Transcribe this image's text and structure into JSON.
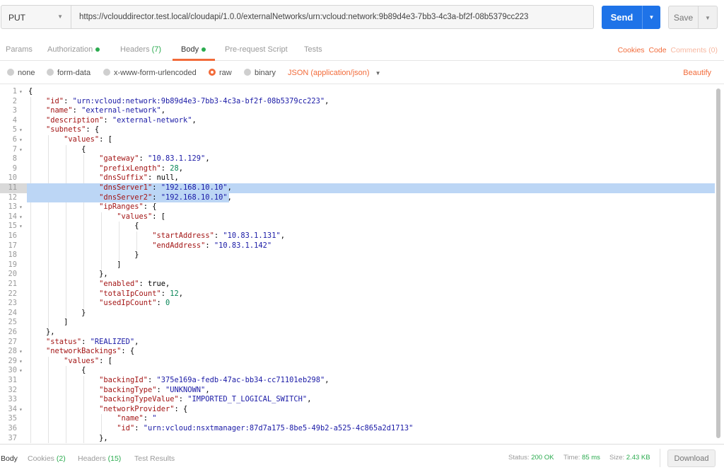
{
  "request": {
    "method": "PUT",
    "url": "https://vclouddirector.test.local/cloudapi/1.0.0/externalNetworks/urn:vcloud:network:9b89d4e3-7bb3-4c3a-bf2f-08b5379cc223",
    "send_label": "Send",
    "save_label": "Save"
  },
  "request_tabs": [
    {
      "label": "Params"
    },
    {
      "label": "Authorization"
    },
    {
      "label": "Headers",
      "count": "(7)"
    },
    {
      "label": "Body"
    },
    {
      "label": "Pre-request Script"
    },
    {
      "label": "Tests"
    }
  ],
  "right_links": {
    "cookies": "Cookies",
    "code": "Code",
    "comments": "Comments (0)"
  },
  "body_types": {
    "none": "none",
    "form_data": "form-data",
    "urlencoded": "x-www-form-urlencoded",
    "raw": "raw",
    "binary": "binary",
    "format": "JSON (application/json)",
    "beautify": "Beautify"
  },
  "editor": {
    "lines": [
      {
        "n": "1",
        "fold": true,
        "indent": 0,
        "tokens": [
          [
            "p",
            "{"
          ]
        ]
      },
      {
        "n": "2",
        "indent": 1,
        "tokens": [
          [
            "k",
            "\"id\""
          ],
          [
            "p",
            ": "
          ],
          [
            "s",
            "\"urn:vcloud:network:9b89d4e3-7bb3-4c3a-bf2f-08b5379cc223\""
          ],
          [
            "p",
            ","
          ]
        ]
      },
      {
        "n": "3",
        "indent": 1,
        "tokens": [
          [
            "k",
            "\"name\""
          ],
          [
            "p",
            ": "
          ],
          [
            "s",
            "\"external-network\""
          ],
          [
            "p",
            ","
          ]
        ]
      },
      {
        "n": "4",
        "indent": 1,
        "tokens": [
          [
            "k",
            "\"description\""
          ],
          [
            "p",
            ": "
          ],
          [
            "s",
            "\"external-network\""
          ],
          [
            "p",
            ","
          ]
        ]
      },
      {
        "n": "5",
        "fold": true,
        "indent": 1,
        "tokens": [
          [
            "k",
            "\"subnets\""
          ],
          [
            "p",
            ": {"
          ]
        ]
      },
      {
        "n": "6",
        "fold": true,
        "indent": 2,
        "tokens": [
          [
            "k",
            "\"values\""
          ],
          [
            "p",
            ": ["
          ]
        ]
      },
      {
        "n": "7",
        "fold": true,
        "indent": 3,
        "tokens": [
          [
            "p",
            "{"
          ]
        ]
      },
      {
        "n": "8",
        "indent": 4,
        "tokens": [
          [
            "k",
            "\"gateway\""
          ],
          [
            "p",
            ": "
          ],
          [
            "s",
            "\"10.83.1.129\""
          ],
          [
            "p",
            ","
          ]
        ]
      },
      {
        "n": "9",
        "indent": 4,
        "tokens": [
          [
            "k",
            "\"prefixLength\""
          ],
          [
            "p",
            ": "
          ],
          [
            "n",
            "28"
          ],
          [
            "p",
            ","
          ]
        ]
      },
      {
        "n": "10",
        "indent": 4,
        "tokens": [
          [
            "k",
            "\"dnsSuffix\""
          ],
          [
            "p",
            ": null,"
          ]
        ]
      },
      {
        "n": "11",
        "indent": 4,
        "hl": "full",
        "tokens": [
          [
            "k",
            "\"dnsServer1\""
          ],
          [
            "p",
            ": "
          ],
          [
            "s",
            "\"192.168.10.10\""
          ],
          [
            "p",
            ","
          ]
        ]
      },
      {
        "n": "12",
        "indent": 4,
        "hl": "part",
        "tokens": [
          [
            "k",
            "\"dnsServer2\""
          ],
          [
            "p",
            ": "
          ],
          [
            "s",
            "\"192.168.10.10\""
          ],
          [
            "p",
            ","
          ]
        ]
      },
      {
        "n": "13",
        "fold": true,
        "indent": 4,
        "tokens": [
          [
            "k",
            "\"ipRanges\""
          ],
          [
            "p",
            ": {"
          ]
        ]
      },
      {
        "n": "14",
        "fold": true,
        "indent": 5,
        "tokens": [
          [
            "k",
            "\"values\""
          ],
          [
            "p",
            ": ["
          ]
        ]
      },
      {
        "n": "15",
        "fold": true,
        "indent": 6,
        "tokens": [
          [
            "p",
            "{"
          ]
        ]
      },
      {
        "n": "16",
        "indent": 7,
        "tokens": [
          [
            "k",
            "\"startAddress\""
          ],
          [
            "p",
            ": "
          ],
          [
            "s",
            "\"10.83.1.131\""
          ],
          [
            "p",
            ","
          ]
        ]
      },
      {
        "n": "17",
        "indent": 7,
        "tokens": [
          [
            "k",
            "\"endAddress\""
          ],
          [
            "p",
            ": "
          ],
          [
            "s",
            "\"10.83.1.142\""
          ]
        ]
      },
      {
        "n": "18",
        "indent": 6,
        "tokens": [
          [
            "p",
            "}"
          ]
        ]
      },
      {
        "n": "19",
        "indent": 5,
        "tokens": [
          [
            "p",
            "]"
          ]
        ]
      },
      {
        "n": "20",
        "indent": 4,
        "tokens": [
          [
            "p",
            "},"
          ]
        ]
      },
      {
        "n": "21",
        "indent": 4,
        "tokens": [
          [
            "k",
            "\"enabled\""
          ],
          [
            "p",
            ": true,"
          ]
        ]
      },
      {
        "n": "22",
        "indent": 4,
        "tokens": [
          [
            "k",
            "\"totalIpCount\""
          ],
          [
            "p",
            ": "
          ],
          [
            "n",
            "12"
          ],
          [
            "p",
            ","
          ]
        ]
      },
      {
        "n": "23",
        "indent": 4,
        "tokens": [
          [
            "k",
            "\"usedIpCount\""
          ],
          [
            "p",
            ": "
          ],
          [
            "n",
            "0"
          ]
        ]
      },
      {
        "n": "24",
        "indent": 3,
        "tokens": [
          [
            "p",
            "}"
          ]
        ]
      },
      {
        "n": "25",
        "indent": 2,
        "tokens": [
          [
            "p",
            "]"
          ]
        ]
      },
      {
        "n": "26",
        "indent": 1,
        "tokens": [
          [
            "p",
            "},"
          ]
        ]
      },
      {
        "n": "27",
        "indent": 1,
        "tokens": [
          [
            "k",
            "\"status\""
          ],
          [
            "p",
            ": "
          ],
          [
            "s",
            "\"REALIZED\""
          ],
          [
            "p",
            ","
          ]
        ]
      },
      {
        "n": "28",
        "fold": true,
        "indent": 1,
        "tokens": [
          [
            "k",
            "\"networkBackings\""
          ],
          [
            "p",
            ": {"
          ]
        ]
      },
      {
        "n": "29",
        "fold": true,
        "indent": 2,
        "tokens": [
          [
            "k",
            "\"values\""
          ],
          [
            "p",
            ": ["
          ]
        ]
      },
      {
        "n": "30",
        "fold": true,
        "indent": 3,
        "tokens": [
          [
            "p",
            "{"
          ]
        ]
      },
      {
        "n": "31",
        "indent": 4,
        "tokens": [
          [
            "k",
            "\"backingId\""
          ],
          [
            "p",
            ": "
          ],
          [
            "s",
            "\"375e169a-fedb-47ac-bb34-cc71101eb298\""
          ],
          [
            "p",
            ","
          ]
        ]
      },
      {
        "n": "32",
        "indent": 4,
        "tokens": [
          [
            "k",
            "\"backingType\""
          ],
          [
            "p",
            ": "
          ],
          [
            "s",
            "\"UNKNOWN\""
          ],
          [
            "p",
            ","
          ]
        ]
      },
      {
        "n": "33",
        "indent": 4,
        "tokens": [
          [
            "k",
            "\"backingTypeValue\""
          ],
          [
            "p",
            ": "
          ],
          [
            "s",
            "\"IMPORTED_T_LOGICAL_SWITCH\""
          ],
          [
            "p",
            ","
          ]
        ]
      },
      {
        "n": "34",
        "fold": true,
        "indent": 4,
        "tokens": [
          [
            "k",
            "\"networkProvider\""
          ],
          [
            "p",
            ": {"
          ]
        ]
      },
      {
        "n": "35",
        "indent": 5,
        "tokens": [
          [
            "k",
            "\"name\""
          ],
          [
            "p",
            ": "
          ],
          [
            "s",
            "\""
          ]
        ]
      },
      {
        "n": "36",
        "indent": 5,
        "tokens": [
          [
            "k",
            "\"id\""
          ],
          [
            "p",
            ": "
          ],
          [
            "s",
            "\"urn:vcloud:nsxtmanager:87d7a175-8be5-49b2-a525-4c865a2d1713\""
          ]
        ]
      },
      {
        "n": "37",
        "indent": 4,
        "tokens": [
          [
            "p",
            "},"
          ]
        ]
      }
    ]
  },
  "response": {
    "tabs": [
      {
        "label": "Body"
      },
      {
        "label": "Cookies",
        "count": "(2)"
      },
      {
        "label": "Headers",
        "count": "(15)"
      },
      {
        "label": "Test Results"
      }
    ],
    "status_label": "Status:",
    "status_value": "200 OK",
    "time_label": "Time:",
    "time_value": "85 ms",
    "size_label": "Size:",
    "size_value": "2.43 KB",
    "download_label": "Download"
  },
  "colors": {
    "accent": "#f26b3a",
    "send": "#1e73e8",
    "ok": "#2bab4f",
    "selection": "#bcd6f5"
  }
}
